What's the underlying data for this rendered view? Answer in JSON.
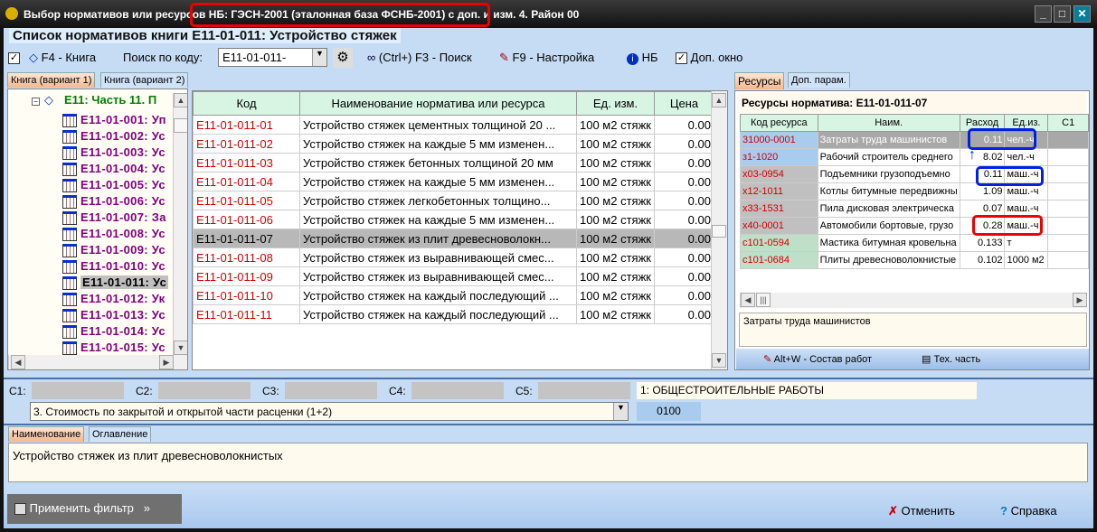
{
  "window": {
    "title_prefix": "Выбор нормативов или ресурсов",
    "title_db": "НБ: ГЭСН-2001 (эталонная база ФСНБ-2001) с доп. и изм. 4. Район 00",
    "minimize": "_",
    "maximize": "□",
    "close": "✕"
  },
  "heading": "Список нормативов книги Е11-01-011: Устройство стяжек",
  "toolbar": {
    "book_label": "F4 - Книга",
    "search_code_label": "Поиск по коду:",
    "search_code_value": "Е11-01-011-",
    "search_label": "(Ctrl+) F3 - Поиск",
    "settings_label": "F9 - Настройка",
    "nb_label": "НБ",
    "extra_window_label": "Доп. окно",
    "extra_window_checked": true,
    "left_checked": true
  },
  "left_tabs": [
    "Книга (вариант 1)",
    "Книга (вариант 2)"
  ],
  "tree": {
    "root": "Е11: Часть 11. П",
    "items": [
      "Е11-01-001: Уп",
      "Е11-01-002: Ус",
      "Е11-01-003: Ус",
      "Е11-01-004: Ус",
      "Е11-01-005: Ус",
      "Е11-01-006: Ус",
      "Е11-01-007: За",
      "Е11-01-008: Ус",
      "Е11-01-009: Ус",
      "Е11-01-010: Ус",
      "Е11-01-011: Ус",
      "Е11-01-012: Ук",
      "Е11-01-013: Ус",
      "Е11-01-014: Ус",
      "Е11-01-015: Ус"
    ],
    "selected_index": 10
  },
  "main_table": {
    "headers": [
      "Код",
      "Наименование норматива или ресурса",
      "Ед. изм.",
      "Цена"
    ],
    "rows": [
      [
        "Е11-01-011-01",
        "Устройство стяжек цементных толщиной 20 ...",
        "100 м2 стяжк",
        "0.00"
      ],
      [
        "Е11-01-011-02",
        "Устройство стяжек на каждые 5 мм изменен...",
        "100 м2 стяжк",
        "0.00"
      ],
      [
        "Е11-01-011-03",
        "Устройство стяжек бетонных толщиной 20 мм",
        "100 м2 стяжк",
        "0.00"
      ],
      [
        "Е11-01-011-04",
        "Устройство стяжек на каждые 5 мм изменен...",
        "100 м2 стяжк",
        "0.00"
      ],
      [
        "Е11-01-011-05",
        "Устройство стяжек легкобетонных толщино...",
        "100 м2 стяжк",
        "0.00"
      ],
      [
        "Е11-01-011-06",
        "Устройство стяжек на каждые 5 мм изменен...",
        "100 м2 стяжк",
        "0.00"
      ],
      [
        "Е11-01-011-07",
        "Устройство стяжек из плит древесноволокн...",
        "100 м2 стяжк",
        "0.00"
      ],
      [
        "Е11-01-011-08",
        "Устройство стяжек из выравнивающей смес...",
        "100 м2 стяжк",
        "0.00"
      ],
      [
        "Е11-01-011-09",
        "Устройство стяжек из выравнивающей смес...",
        "100 м2 стяжк",
        "0.00"
      ],
      [
        "Е11-01-011-10",
        "Устройство стяжек на каждый последующий ...",
        "100 м2 стяжк",
        "0.00"
      ],
      [
        "Е11-01-011-11",
        "Устройство стяжек на каждый последующий ...",
        "100 м2 стяжк",
        "0.00"
      ]
    ],
    "selected_index": 6
  },
  "right_tabs": [
    "Ресурсы",
    "Доп. парам."
  ],
  "resources": {
    "title": "Ресурсы норматива: Е11-01-011-07",
    "headers": [
      "Код ресурса",
      "Наим.",
      "Расход",
      "Ед.из.",
      "С1"
    ],
    "rows": [
      [
        "31000-0001",
        "Затраты труда машинистов",
        "0.11",
        "чел.-ч",
        ""
      ],
      [
        "з1-1020",
        "Рабочий строитель среднего",
        "8.02",
        "чел.-ч",
        ""
      ],
      [
        "х03-0954",
        "Подъемники грузоподъемно",
        "0.11",
        "маш.-ч",
        ""
      ],
      [
        "х12-1011",
        "Котлы битумные передвижны",
        "1.09",
        "маш.-ч",
        ""
      ],
      [
        "х33-1531",
        "Пила дисковая электрическа",
        "0.07",
        "маш.-ч",
        ""
      ],
      [
        "х40-0001",
        "Автомобили бортовые, грузо",
        "0.28",
        "маш.-ч",
        ""
      ],
      [
        "с101-0594",
        "Мастика битумная кровельна",
        "0.133",
        "т",
        ""
      ],
      [
        "с101-0684",
        "Плиты древесноволокнистые",
        "0.102",
        "1000 м2",
        ""
      ]
    ],
    "code_colors": [
      "#a9cbee",
      "#a9cbee",
      "#c0c0c0",
      "#c0c0c0",
      "#c0c0c0",
      "#c0c0c0",
      "#c0dfc8",
      "#c0dfc8"
    ],
    "description": "Затраты труда машинистов",
    "work_composition": "Alt+W - Состав работ",
    "tech_part": "Тех. часть"
  },
  "params": {
    "c_labels": [
      "С1:",
      "С2:",
      "С3:",
      "С4:",
      "С5:"
    ],
    "section": "1: ОБЩЕСТРОИТЕЛЬНЫЕ РАБОТЫ",
    "cost_mode": "3. Стоимость по закрытой и открытой части расценки (1+2)",
    "code": "0100"
  },
  "bottom_tabs": [
    "Наименование",
    "Оглавление"
  ],
  "name_text": "Устройство стяжек из плит древесноволокнистых",
  "footer": {
    "filter": "Применить фильтр",
    "filter_more": "»",
    "cancel": "Отменить",
    "help": "Справка"
  },
  "colors": {
    "highlight_red": "#e00000",
    "highlight_blue": "#0020e0",
    "code_red": "#d00000",
    "tree_purple": "#800080",
    "tree_root_green": "#008000"
  }
}
